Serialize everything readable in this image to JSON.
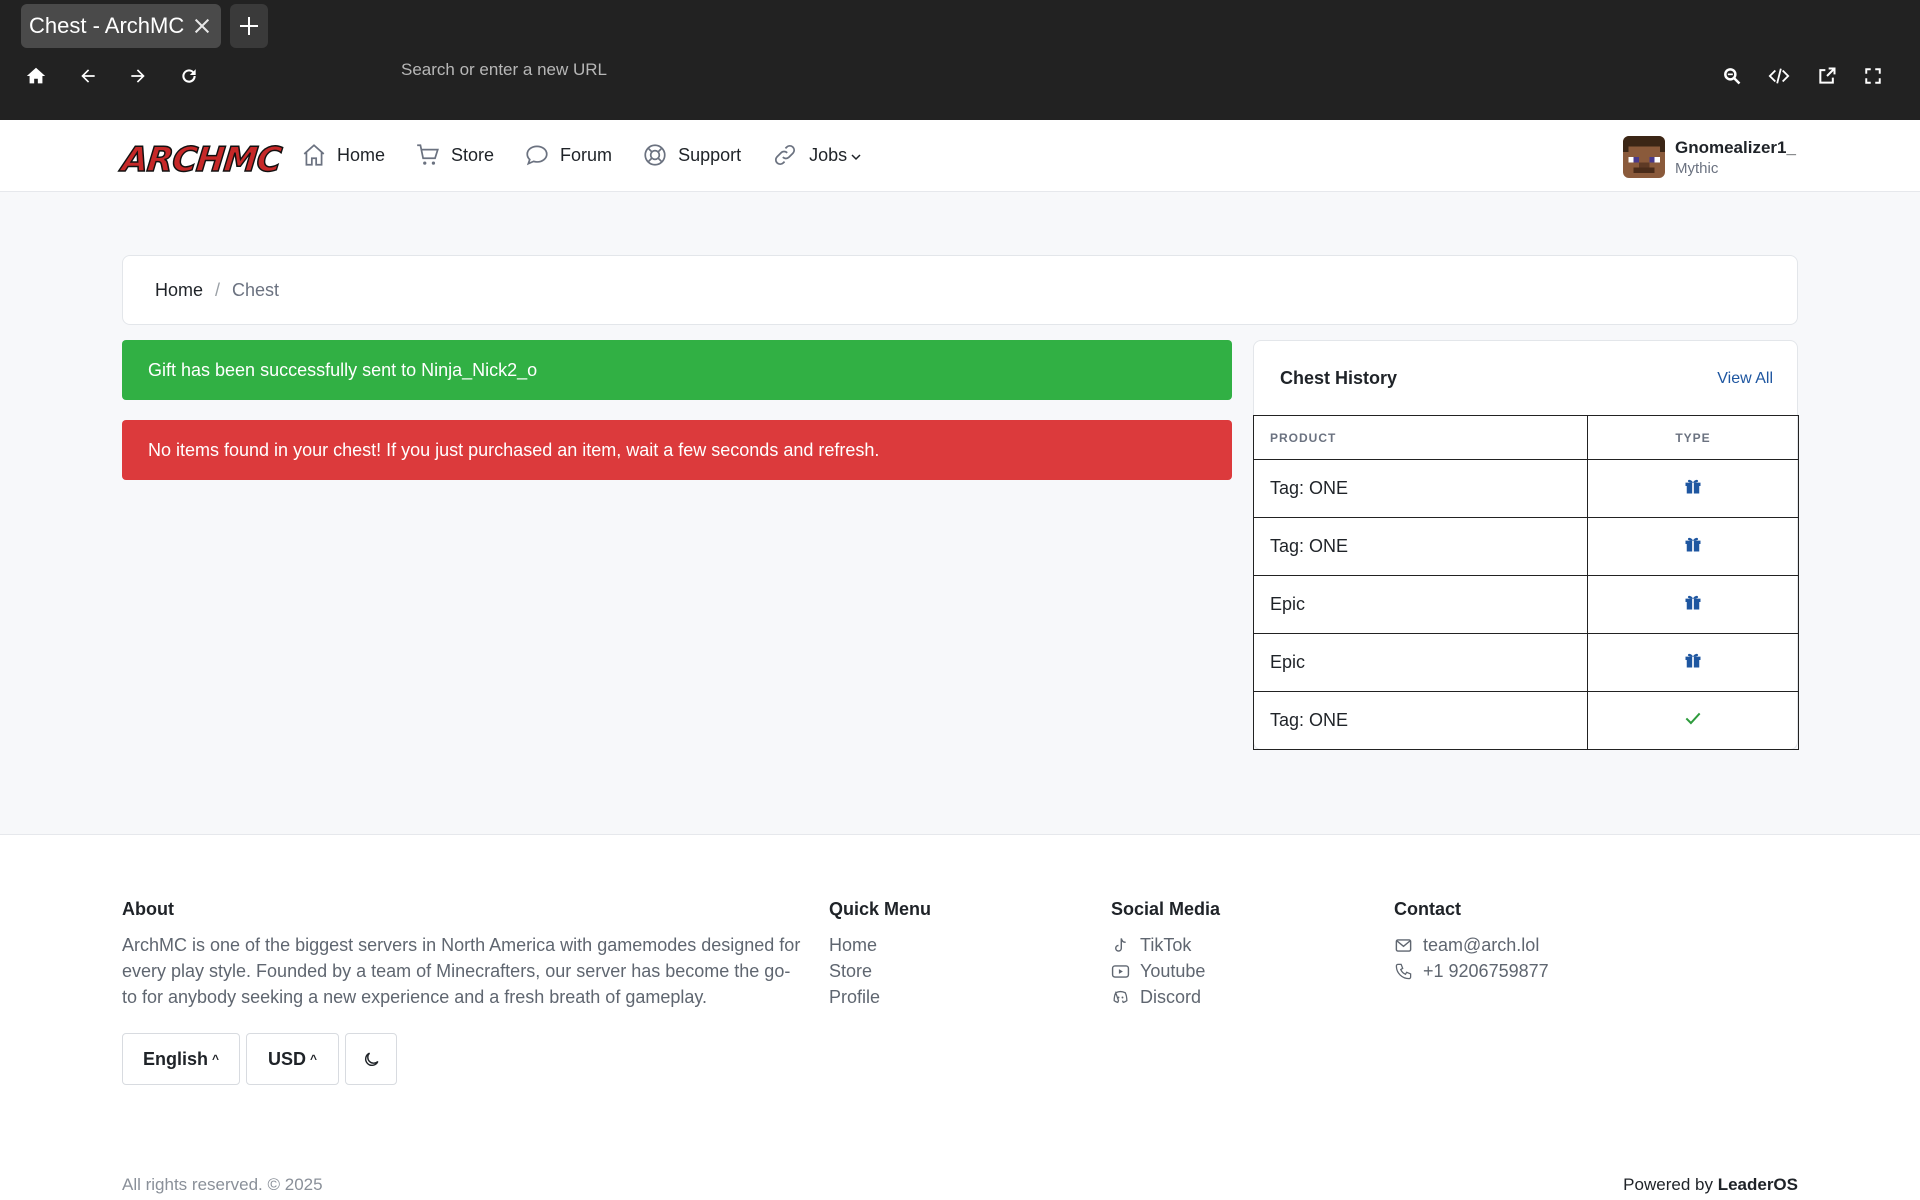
{
  "browser": {
    "tab_title": "Chest - ArchMC",
    "url_placeholder": "Search or enter a new URL"
  },
  "header": {
    "logo_text": "ARCHMC",
    "nav": [
      {
        "label": "Home",
        "icon": "house-icon"
      },
      {
        "label": "Store",
        "icon": "cart-icon"
      },
      {
        "label": "Forum",
        "icon": "chat-bubble-icon"
      },
      {
        "label": "Support",
        "icon": "lifebuoy-icon"
      },
      {
        "label": "Jobs",
        "icon": "link-icon"
      }
    ],
    "user": {
      "name": "Gnomealizer1_",
      "rank": "Mythic"
    }
  },
  "breadcrumb": {
    "home": "Home",
    "separator": "/",
    "current": "Chest"
  },
  "alerts": {
    "success": "Gift has been successfully sent to Ninja_Nick2_o",
    "error": "No items found in your chest! If you just purchased an item, wait a few seconds and refresh."
  },
  "chest_history": {
    "title": "Chest History",
    "view_all": "View All",
    "columns": [
      "PRODUCT",
      "TYPE"
    ],
    "rows": [
      {
        "product": "Tag: ONE",
        "type": "gift-icon"
      },
      {
        "product": "Tag: ONE",
        "type": "gift-icon"
      },
      {
        "product": "Epic",
        "type": "gift-icon"
      },
      {
        "product": "Epic",
        "type": "gift-icon"
      },
      {
        "product": "Tag: ONE",
        "type": "check-icon"
      }
    ]
  },
  "footer": {
    "about_title": "About",
    "about_text": "ArchMC is one of the biggest servers in North America with gamemodes designed for every play style. Founded by a team of Minecrafters, our server has become the go-to for anybody seeking a new experience and a fresh breath of gameplay.",
    "quick_title": "Quick Menu",
    "quick_links": [
      "Home",
      "Store",
      "Profile"
    ],
    "social_title": "Social Media",
    "social_links": [
      "TikTok",
      "Youtube",
      "Discord"
    ],
    "contact_title": "Contact",
    "email": "team@arch.lol",
    "phone": "+1 9206759877",
    "language": "English",
    "currency": "USD",
    "copyright": "All rights reserved. © 2025",
    "powered_prefix": "Powered by",
    "powered_brand": "LeaderOS"
  },
  "colors": {
    "success": "#31b044",
    "danger": "#dc3a3c",
    "link": "#1e56a0",
    "gift": "#1e56a0",
    "check": "#2e9b3d"
  }
}
